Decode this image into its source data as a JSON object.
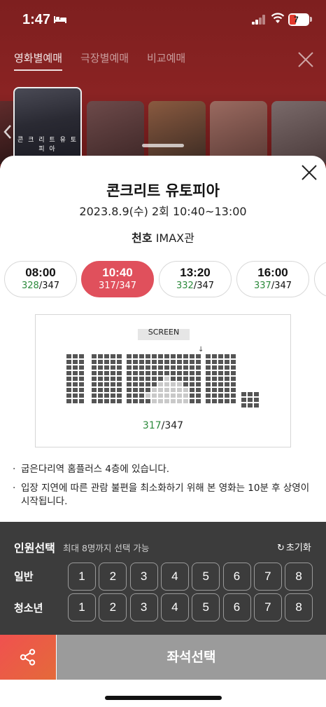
{
  "status": {
    "time": "1:47",
    "battery": "7"
  },
  "tabs": [
    {
      "label": "영화별예매",
      "active": true
    },
    {
      "label": "극장별예매",
      "active": false
    },
    {
      "label": "비교예매",
      "active": false
    }
  ],
  "posters": {
    "selected_caption": "콘 크 리 트 유 토 피 아"
  },
  "movie": {
    "title": "콘크리트 유토피아",
    "showinfo": "2023.8.9(수) 2회 10:40~13:00",
    "theater_name": "천호",
    "theater_hall": "IMAX관"
  },
  "showtimes": [
    {
      "time": "08:00",
      "available": "328",
      "total": "/347",
      "active": false
    },
    {
      "time": "10:40",
      "available": "317",
      "total": "/347",
      "active": true
    },
    {
      "time": "13:20",
      "available": "332",
      "total": "/347",
      "active": false
    },
    {
      "time": "16:00",
      "available": "337",
      "total": "/347",
      "active": false
    }
  ],
  "seatmap": {
    "screen_label": "SCREEN",
    "available": "317",
    "total": "/347",
    "colors": {
      "taken": "#555555",
      "available": "#c9c9c9"
    }
  },
  "notes": [
    "굽은다리역 홈플러스 4층에 있습니다.",
    "입장 지연에 따른 관람 불편을 최소화하기 위해 본 영화는 10분 후 상영이 시작됩니다."
  ],
  "people": {
    "title": "인원선택",
    "subtitle": "최대 8명까지 선택 가능",
    "reset_label": "초기화",
    "rows": [
      {
        "label": "일반",
        "options": [
          "1",
          "2",
          "3",
          "4",
          "5",
          "6",
          "7",
          "8"
        ]
      },
      {
        "label": "청소년",
        "options": [
          "1",
          "2",
          "3",
          "4",
          "5",
          "6",
          "7",
          "8"
        ]
      }
    ]
  },
  "footer": {
    "select_label": "좌석선택"
  },
  "colors": {
    "accent": "#e0505c",
    "green": "#2c8a3c",
    "panel": "#3c3c3c"
  }
}
